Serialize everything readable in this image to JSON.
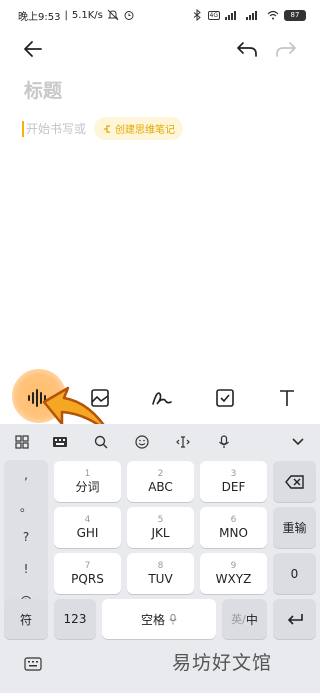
{
  "status_bar": {
    "time": "晚上9:53",
    "net_speed": "5.1K/s",
    "battery": "87",
    "network_type": "4G"
  },
  "header": {
    "back_icon": "arrow-left-icon",
    "undo_icon": "undo-icon",
    "redo_icon": "redo-icon"
  },
  "editor": {
    "title_placeholder": "标题",
    "body_placeholder": "开始书写或",
    "mindmap_button": "创建思维笔记"
  },
  "toolbar": {
    "items": [
      "voice-input-icon",
      "image-icon",
      "handwriting-icon",
      "checklist-icon",
      "text-format-icon"
    ]
  },
  "keyboard": {
    "symbols": [
      ",",
      "。",
      "?",
      "!",
      "@"
    ],
    "keys": [
      {
        "num": "1",
        "let": "分词"
      },
      {
        "num": "2",
        "let": "ABC"
      },
      {
        "num": "3",
        "let": "DEF"
      },
      {
        "num": "4",
        "let": "GHI"
      },
      {
        "num": "5",
        "let": "JKL"
      },
      {
        "num": "6",
        "let": "MNO"
      },
      {
        "num": "7",
        "let": "PQRS"
      },
      {
        "num": "8",
        "let": "TUV"
      },
      {
        "num": "9",
        "let": "WXYZ"
      }
    ],
    "rekey_label": "重输",
    "zero_label": "0",
    "symbol_key": "符",
    "num_key": "123",
    "space_key": "空格",
    "lang_key": "英/中",
    "lang_key_en": "英",
    "lang_key_sep": "/",
    "lang_key_cn": "中"
  },
  "watermark": "易坊好文馆"
}
